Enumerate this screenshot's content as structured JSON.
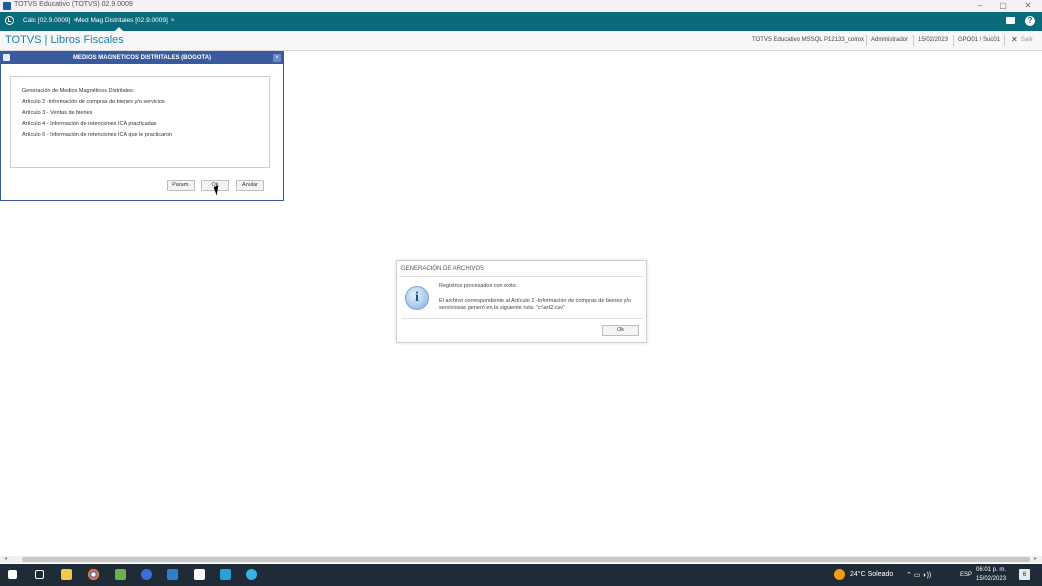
{
  "window": {
    "title": "TOTVS Educativo (TOTVS) 02.9.0009",
    "minimize": "–",
    "restore": "▢",
    "close": "✕"
  },
  "tabs": [
    {
      "label": "Cálc [02.9.0009]",
      "close": "×"
    },
    {
      "label": "Med Mag Distritales [02.9.0009]",
      "close": "×"
    }
  ],
  "header": {
    "brand": "TOTVS | Libros Fiscales",
    "environment": "TOTVS Educativo MSSQL P12133_colrox",
    "user": "Administrador",
    "date": "15/02/2023",
    "branch": "GPO01 / Suc01",
    "exit_icon": "✕",
    "exit": "Salir"
  },
  "dialog_main": {
    "title": "MEDIOS MAGNETICOS DISTRITALES (BOGOTA)",
    "close": "×",
    "lines": [
      "Generación de Medios Magnéticos Distritales:",
      "Artículo 2 -Información de compras de bienes y/o servicios",
      "Artículo 3 - Ventas de bienes",
      "Artículo 4 - Información de retenciones ICA practicadas",
      "Artículo 6 - Información de retenciones ICA que le practicaron"
    ],
    "buttons": {
      "params": "Param.",
      "ok": "Ok",
      "cancel": "Anular"
    }
  },
  "dialog_msg": {
    "title": "GENERACIÓN DE ARCHIVOS",
    "icon": "i",
    "line1": "Registros procesados con éxito.",
    "line2": "El archivo correspondiente al Artículo 2 -Información de compras de bienes y/o",
    "line3": "serviciosse generó en la siguiente ruta: \"c:\\art2.csv\"",
    "ok": "Ok"
  },
  "scrollbar": {
    "left": "◂",
    "right": "▸"
  },
  "taskbar": {
    "weather": "24°C  Soleado",
    "tray_symbols": "⌃  ▭  ◗))",
    "language": "ESP",
    "time": "06:01 p. m.",
    "date": "15/02/2023",
    "notifications": "6"
  }
}
